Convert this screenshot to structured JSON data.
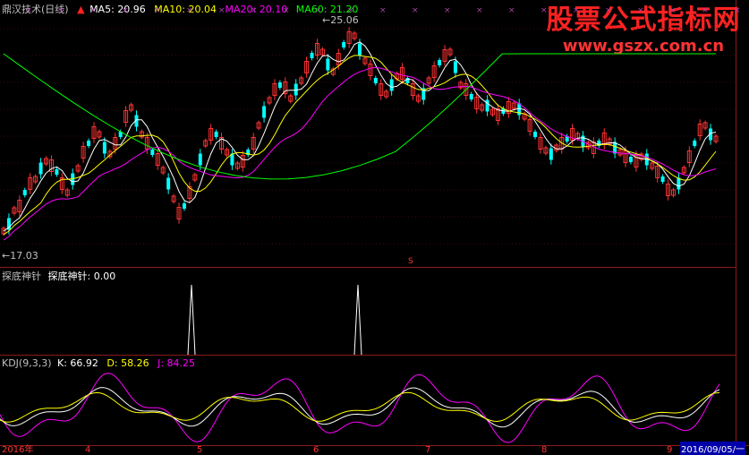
{
  "header": {
    "app_title": "鼎汉技术(日线)",
    "ma5": "MA5: 20.96",
    "ma10": "MA10: 20.04",
    "ma20": "MA20: 20.10",
    "ma60": "MA60: 21.20"
  },
  "price_pane": {
    "high_label": "25.06",
    "low_label": "17.03",
    "center_marker": "S"
  },
  "indicator_pane": {
    "title": "探底神针",
    "value_label": "探底神针: 0.00"
  },
  "kdj_pane": {
    "title": "KDJ(9,3,3)",
    "k": "K: 66.92",
    "d": "D: 58.26",
    "j": "J: 84.25"
  },
  "axis": {
    "labels": [
      "2016年",
      "4",
      "5",
      "6",
      "7",
      "8",
      "9",
      "2016/09/05/一"
    ]
  },
  "banner": {
    "title": "股票公式指标网",
    "url": "www.gszx.com.cn"
  },
  "colors": {
    "ma5": "#ffffff",
    "ma10": "#ffff00",
    "ma20": "#ff00ff",
    "ma60": "#00ff00",
    "up": "#ff3333",
    "down": "#00ffff",
    "grid": "#8b1a1a"
  }
}
